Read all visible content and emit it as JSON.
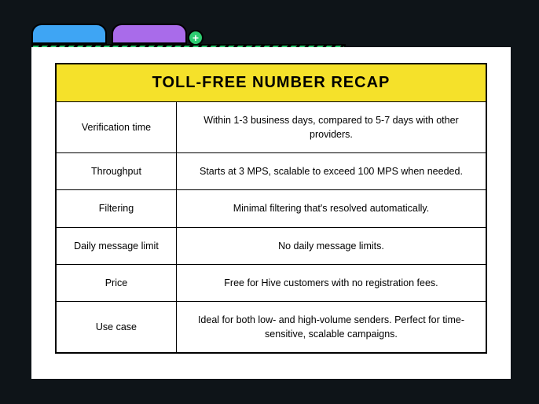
{
  "tabs": {
    "plus_label": "+"
  },
  "table": {
    "title": "TOLL-FREE NUMBER RECAP",
    "rows": [
      {
        "label": "Verification time",
        "value": "Within 1-3 business days, compared to 5-7 days with other providers."
      },
      {
        "label": "Throughput",
        "value": "Starts at 3 MPS, scalable to exceed 100 MPS when needed."
      },
      {
        "label": "Filtering",
        "value": "Minimal filtering that's resolved automatically."
      },
      {
        "label": "Daily message limit",
        "value": "No daily message limits."
      },
      {
        "label": "Price",
        "value": "Free for Hive customers with no registration fees."
      },
      {
        "label": "Use case",
        "value": "Ideal for both low- and high-volume senders. Perfect for time-sensitive, scalable campaigns."
      }
    ]
  }
}
